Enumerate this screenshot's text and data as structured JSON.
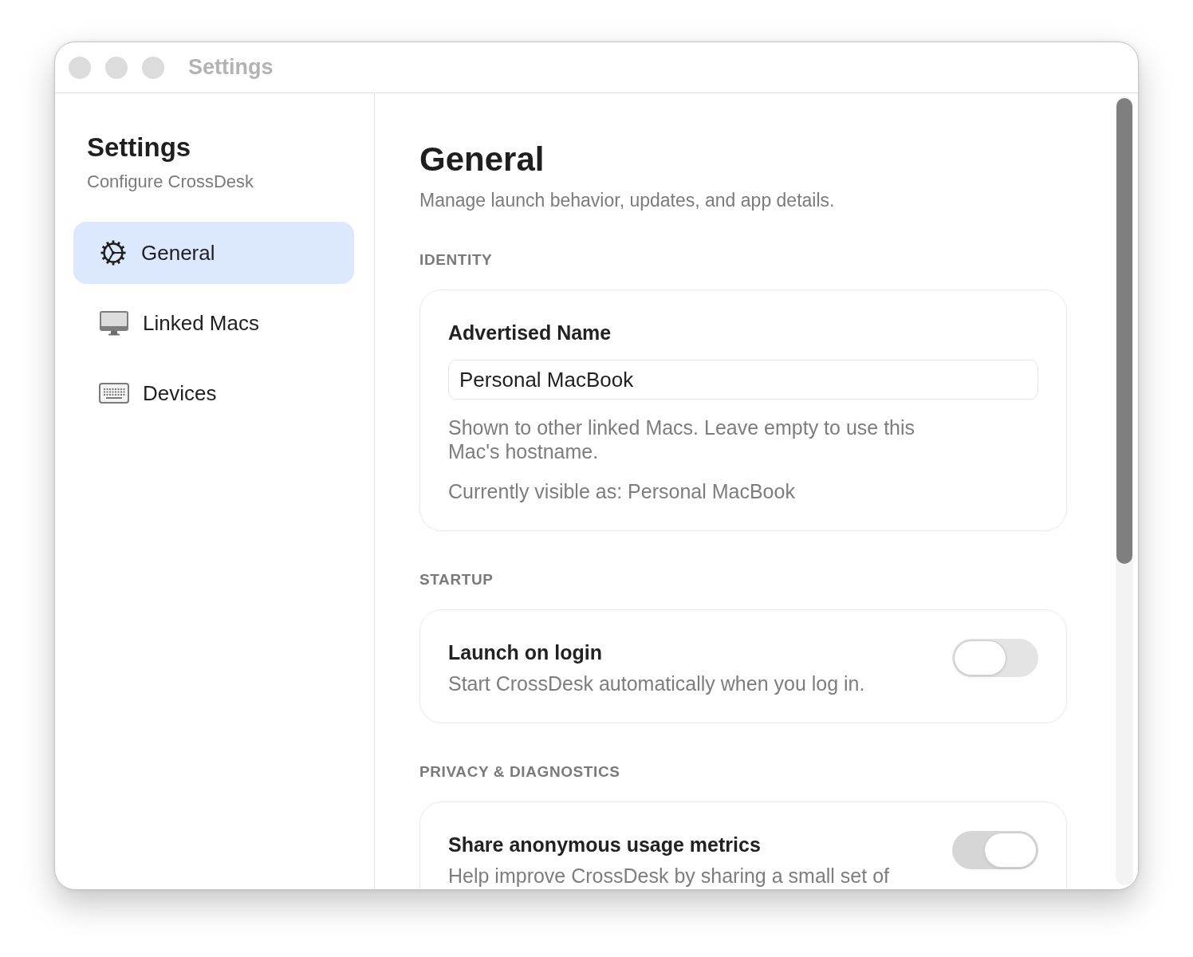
{
  "window": {
    "title": "Settings"
  },
  "sidebar": {
    "title": "Settings",
    "subtitle": "Configure CrossDesk",
    "items": [
      {
        "label": "General",
        "selected": true
      },
      {
        "label": "Linked Macs",
        "selected": false
      },
      {
        "label": "Devices",
        "selected": false
      }
    ]
  },
  "content": {
    "title": "General",
    "subtitle": "Manage launch behavior, updates, and app details.",
    "sections": [
      {
        "heading": "IDENTITY",
        "kind": "field",
        "label": "Advertised Name",
        "value": "Personal MacBook",
        "help": "Shown to other linked Macs. Leave empty to use this Mac's hostname.",
        "note": "Currently visible as: Personal MacBook"
      },
      {
        "heading": "STARTUP",
        "kind": "toggle",
        "label": "Launch on login",
        "description": "Start CrossDesk automatically when you log in.",
        "on": false
      },
      {
        "heading": "PRIVACY & DIAGNOSTICS",
        "kind": "toggle",
        "label": "Share anonymous usage metrics",
        "description": "Help improve CrossDesk by sharing a small set of",
        "on": true
      }
    ]
  }
}
